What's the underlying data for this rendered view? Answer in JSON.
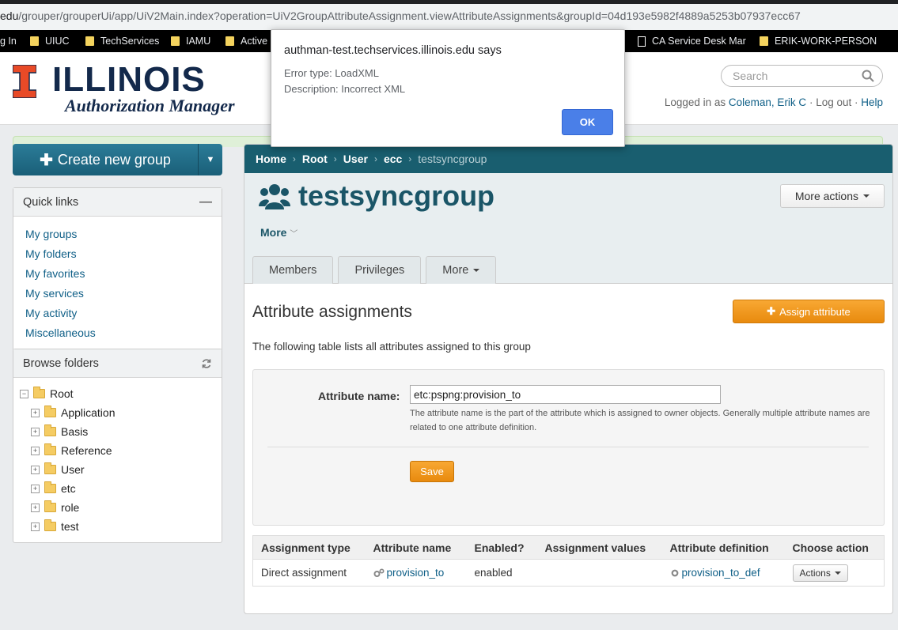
{
  "browser": {
    "url_prefix": "edu",
    "url_path": "/grouper/grouperUi/app/UiV2Main.index?operation=UiV2GroupAttributeAssignment.viewAttributeAssignments&groupId=04d193e5982f4889a5253b07937ecc67",
    "bookmarks": [
      {
        "label": "g In",
        "icon": "none"
      },
      {
        "label": "UIUC",
        "icon": "folder-icon"
      },
      {
        "label": "TechServices",
        "icon": "folder-icon"
      },
      {
        "label": "IAMU",
        "icon": "folder-icon"
      },
      {
        "label": "Active",
        "icon": "folder-icon"
      },
      {
        "label": "CA Service Desk Mar",
        "icon": "page-icon"
      },
      {
        "label": "ERIK-WORK-PERSON",
        "icon": "folder-icon"
      }
    ]
  },
  "header": {
    "logo_text": "ILLINOIS",
    "logo_sub": "Authorization Manager",
    "brand_colors": {
      "navy": "#13294b",
      "orange": "#e84a27"
    },
    "search_placeholder": "Search",
    "logged_in_prefix": "Logged in as",
    "user_name": "Coleman, Erik C",
    "logout_label": "Log out",
    "help_label": "Help"
  },
  "sidebar": {
    "create_button": "Create new group",
    "quick_links_title": "Quick links",
    "quick_links": [
      "My groups",
      "My folders",
      "My favorites",
      "My services",
      "My activity",
      "Miscellaneous"
    ],
    "browse_title": "Browse folders",
    "tree_root": "Root",
    "tree_children": [
      "Application",
      "Basis",
      "Reference",
      "User",
      "etc",
      "role",
      "test"
    ]
  },
  "breadcrumb": {
    "items": [
      "Home",
      "Root",
      "User",
      "ecc"
    ],
    "current": "testsyncgroup"
  },
  "group": {
    "title": "testsyncgroup",
    "more_actions": "More actions",
    "more_label": "More",
    "tabs": [
      "Members",
      "Privileges",
      "More"
    ]
  },
  "assignments": {
    "title": "Attribute assignments",
    "assign_button": "Assign attribute",
    "description": "The following table lists all attributes assigned to this group",
    "form": {
      "label": "Attribute name:",
      "value": "etc:pspng:provision_to",
      "help": "The attribute name is the part of the attribute which is assigned to owner objects. Generally multiple attribute names are related to one attribute definition.",
      "save_label": "Save"
    },
    "table": {
      "headers": [
        "Assignment type",
        "Attribute name",
        "Enabled?",
        "Assignment values",
        "Attribute definition",
        "Choose action"
      ],
      "rows": [
        {
          "type": "Direct assignment",
          "name": "provision_to",
          "enabled": "enabled",
          "values": "",
          "definition": "provision_to_def",
          "action": "Actions"
        }
      ]
    }
  },
  "dialog": {
    "title": "authman-test.techservices.illinois.edu says",
    "line1": "Error type: LoadXML",
    "line2": "Description: Incorrect XML",
    "ok_label": "OK"
  }
}
